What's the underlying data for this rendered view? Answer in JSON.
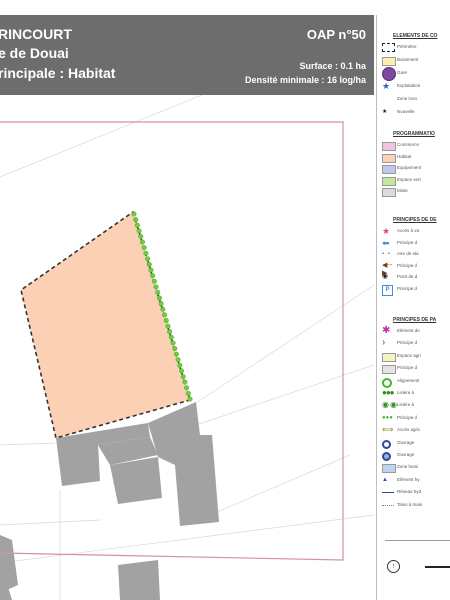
{
  "header": {
    "commune": "RINCOURT",
    "quartier": "e de Douai",
    "vocation": "rincipale : Habitat",
    "oap": "OAP n°50",
    "surface": "Surface : 0.1 ha",
    "densite": "Densité minimale : 16 log/ha"
  },
  "colors": {
    "header_bg": "#6d6d6d",
    "habitat": "#fbd0b5",
    "building": "#a2a2a2",
    "perimeter": "#d98ea5",
    "hedge": "#6fce3b",
    "boundary": "#333333"
  },
  "legend": {
    "sections": [
      {
        "title": "ELEMENTS DE CO",
        "items": [
          {
            "label": "Périmètre",
            "icon": "dashed-rect-icon"
          },
          {
            "label": "Boisement",
            "icon": "yellow-rect-icon"
          },
          {
            "label": "Gare",
            "icon": "train-station-icon"
          },
          {
            "label": "Exploitation",
            "icon": "star-icon"
          },
          {
            "label": "Zone inon",
            "icon": "blank-icon"
          },
          {
            "label": "Nouvelle",
            "icon": "small-star-icon"
          }
        ]
      },
      {
        "title": "PROGRAMMATIO",
        "items": [
          {
            "label": "Commerce",
            "icon": "pink-rect-icon"
          },
          {
            "label": "Habitat",
            "icon": "habitat-rect-icon"
          },
          {
            "label": "Equipement",
            "icon": "lavender-rect-icon"
          },
          {
            "label": "Espace vert",
            "icon": "green-rect-icon"
          },
          {
            "label": "Mixte",
            "icon": "grey-rect-icon"
          }
        ]
      },
      {
        "title": "PRINCIPES DE DE",
        "items": [
          {
            "label": "Accès à va",
            "icon": "pink-star-icon"
          },
          {
            "label": "Principe d",
            "icon": "blue-arrow-icon"
          },
          {
            "label": "Aire de sta",
            "icon": "blue-dotted-icon"
          },
          {
            "label": "Principe d",
            "icon": "double-arrow-icon"
          },
          {
            "label": "Point de d",
            "icon": "point-icon"
          },
          {
            "label": "Principe d",
            "icon": "parking-icon"
          }
        ]
      },
      {
        "title": "PRINCIPES DE PA",
        "items": [
          {
            "label": "Elément de",
            "icon": "flower-icon"
          },
          {
            "label": "Principe d",
            "icon": "chevron-icon"
          },
          {
            "label": "Espace agri",
            "icon": "pale-yellow-rect-icon"
          },
          {
            "label": "Principe d",
            "icon": "light-grey-rect-icon"
          },
          {
            "label": "Alignement",
            "icon": "green-circle-icon"
          },
          {
            "label": "Lisière à",
            "icon": "tree-cluster-icon"
          },
          {
            "label": "Lisière à",
            "icon": "double-circle-icon"
          },
          {
            "label": "Principe d",
            "icon": "green-dots-icon"
          },
          {
            "label": "Accès agric",
            "icon": "olive-arrow-icon"
          },
          {
            "label": "Ouvrage",
            "icon": "blue-ring-icon"
          },
          {
            "label": "Ouvrage",
            "icon": "blue-ring2-icon"
          },
          {
            "label": "Zone humi",
            "icon": "light-blue-rect-icon"
          },
          {
            "label": "Elément hy",
            "icon": "triangle-icon"
          },
          {
            "label": "Réseau hyd",
            "icon": "blue-line-icon"
          },
          {
            "label": "Talus à main",
            "icon": "dotted-line-icon"
          }
        ]
      }
    ]
  }
}
